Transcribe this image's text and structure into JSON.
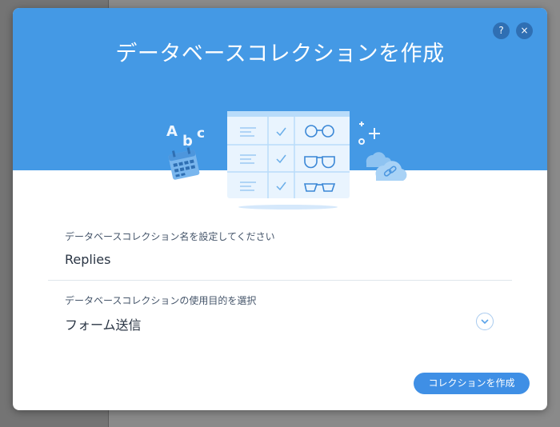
{
  "dialog": {
    "title": "データベースコレクションを作成",
    "help_label": "?",
    "close_label": "×",
    "illustration": {
      "letters": [
        "A",
        "b",
        "c"
      ]
    }
  },
  "form": {
    "name_label": "データベースコレクション名を設定してください",
    "name_value": "Replies",
    "purpose_label": "データベースコレクションの使用目的を選択",
    "purpose_value": "フォーム送信"
  },
  "footer": {
    "create_label": "コレクションを作成"
  },
  "colors": {
    "header_blue": "#4499e5",
    "button_blue": "#3f8fe5"
  },
  "icons": [
    "question-icon",
    "close-icon",
    "chevron-down-icon",
    "calendar-icon",
    "cloud-icon",
    "glasses-icon",
    "check-icon",
    "plus-icon"
  ]
}
